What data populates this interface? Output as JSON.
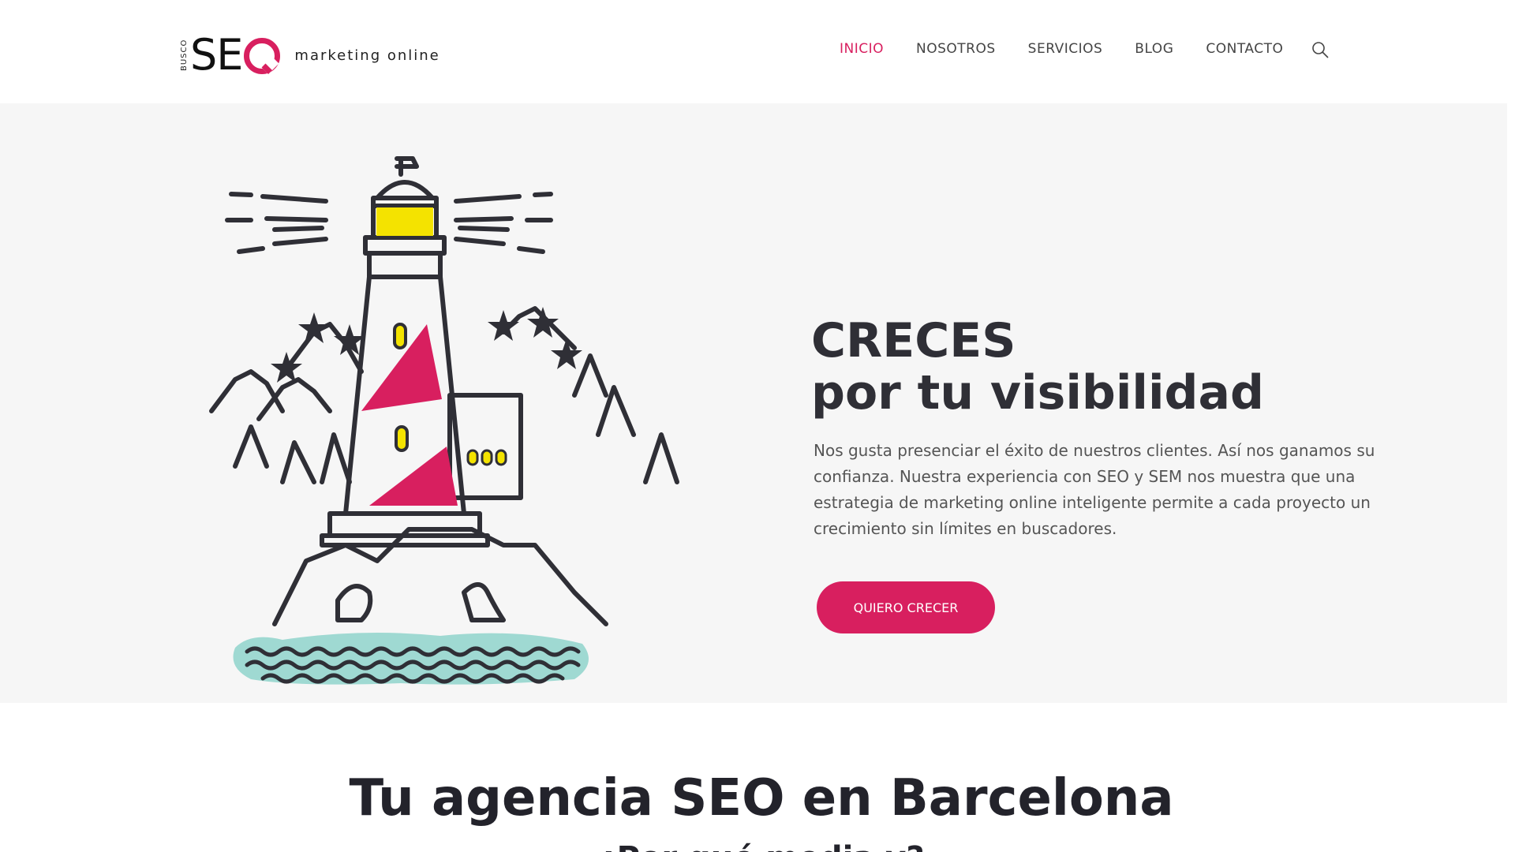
{
  "logo": {
    "busco": "BUSCO",
    "seo_letters": "SE",
    "tagline": "marketing online"
  },
  "nav": {
    "items": [
      {
        "label": "INICIO",
        "active": true
      },
      {
        "label": "NOSOTROS",
        "active": false
      },
      {
        "label": "SERVICIOS",
        "active": false
      },
      {
        "label": "BLOG",
        "active": false
      },
      {
        "label": "CONTACTO",
        "active": false
      }
    ],
    "search_icon": "search-icon"
  },
  "hero": {
    "title_line1": "CRECES",
    "title_line2": "por tu visibilidad",
    "text": "Nos gusta presenciar el éxito de nuestros clientes. Así nos ganamos su confianza. Nuestra experiencia con SEO y SEM nos muestra que una estrategia de marketing online inteligente permite a cada proyecto un crecimiento sin límites en buscadores.",
    "button_label": "QUIERO CRECER",
    "illustration": "lighthouse-illustration"
  },
  "section": {
    "title": "Tu agencia SEO en Barcelona",
    "subtitle": "¿Por qué media y?"
  },
  "colors": {
    "accent": "#d81f5f",
    "hero_bg": "#f6f6f6",
    "text_dark": "#23232b",
    "yellow": "#f4e300",
    "water": "#9fd9d2"
  }
}
